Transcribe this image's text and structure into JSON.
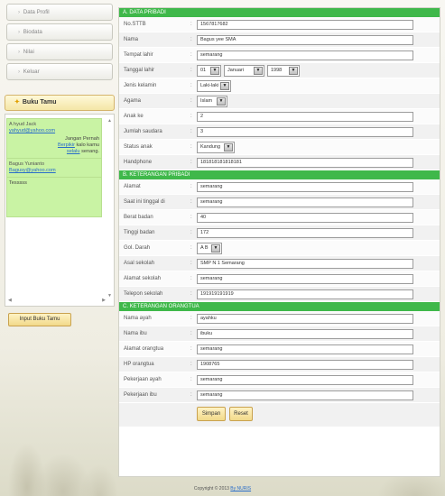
{
  "sidebar": {
    "nav": [
      {
        "label": "Data Profil"
      },
      {
        "label": "Biodata"
      },
      {
        "label": "Nilai"
      },
      {
        "label": "Keluar"
      }
    ],
    "bukutamu_title": "Buku Tamu",
    "messages": [
      {
        "name": "A hyud Jack",
        "email": "yahyud@yahoo.com",
        "text_pre": "Jangan Pernah",
        "text_link1": "Berpikir",
        "text_mid": " kalo kamu ",
        "text_link2": "selalu",
        "text_post": " senang."
      },
      {
        "name": "Bagus Yunianto",
        "email": "Bagusy@yahoo.com"
      },
      {
        "plain": "Tesssss"
      }
    ],
    "input_button": "Input Buku Tamu"
  },
  "form": {
    "sections": [
      {
        "title": "A. DATA PRIBADI",
        "rows": [
          {
            "label": "No.STTB",
            "value": "1567817682"
          },
          {
            "label": "Nama",
            "value": "Bagus yee SMA"
          },
          {
            "label": "Tempat lahir",
            "value": "semarang"
          },
          {
            "label": "Tanggal lahir",
            "day": "01",
            "month": "Januari",
            "year": "1998"
          },
          {
            "label": "Jenis kelamin",
            "select": "Laki-laki"
          },
          {
            "label": "Agama",
            "select": "Islam"
          },
          {
            "label": "Anak ke",
            "value": "2"
          },
          {
            "label": "Jumlah saudara",
            "value": "3"
          },
          {
            "label": "Status anak",
            "select": "Kandung"
          },
          {
            "label": "Handphone",
            "value": "181818181818181"
          }
        ]
      },
      {
        "title": "B. KETERANGAN PRIBADI",
        "rows": [
          {
            "label": "Alamat",
            "value": "semarang"
          },
          {
            "label": "Saat ini tinggal di",
            "value": "semarang"
          },
          {
            "label": "Berat badan",
            "value": "40"
          },
          {
            "label": "Tinggi badan",
            "value": "172"
          },
          {
            "label": "Gol. Darah",
            "select": "A B"
          },
          {
            "label": "Asal sekolah",
            "value": "SMP N 1 Semarang"
          },
          {
            "label": "Alamat sekolah",
            "value": "semarang"
          },
          {
            "label": "Telepon sekolah",
            "value": "191919191919"
          }
        ]
      },
      {
        "title": "C. KETERANGAN ORANGTUA",
        "rows": [
          {
            "label": "Nama ayah",
            "value": "ayahku"
          },
          {
            "label": "Nama ibu",
            "value": "ibuku"
          },
          {
            "label": "Alamat orangtua",
            "value": "semarang"
          },
          {
            "label": "HP orangtua",
            "value": "1908765"
          },
          {
            "label": "Pekerjaan ayah",
            "value": "semarang"
          },
          {
            "label": "Pekerjaan ibu",
            "value": "semarang"
          }
        ]
      }
    ],
    "buttons": {
      "save": "Simpan",
      "reset": "Reset"
    }
  },
  "footer": {
    "text": "Copyright © 2013",
    "link": "By NURIS"
  },
  "colors": {
    "section_header": "#3fb84a",
    "button": "#f2d98a",
    "guestbook": "#c9f3a4"
  },
  "icons": {
    "nav_arrow": "chevron-right-icon",
    "dropdown": "dropdown-arrow-icon",
    "bukutamu": "star-icon"
  }
}
